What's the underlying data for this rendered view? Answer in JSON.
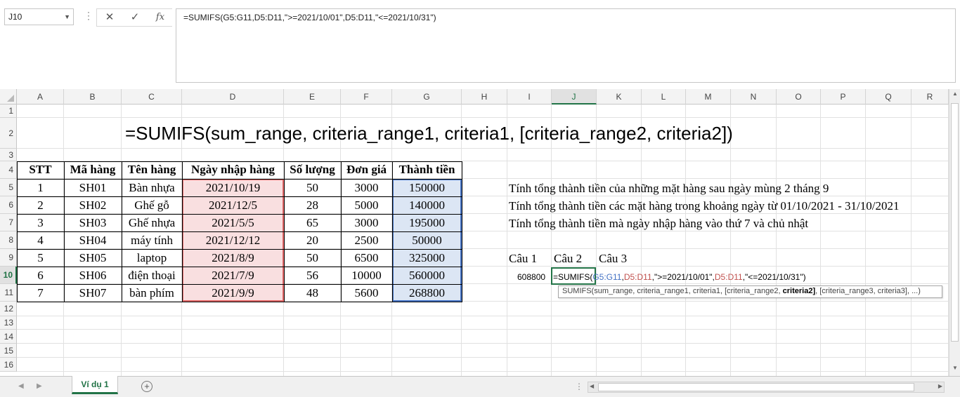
{
  "formula_bar": {
    "name_box": "J10",
    "formula": "=SUMIFS(G5:G11,D5:D11,\">=2021/10/01\",D5:D11,\"<=2021/10/31\")",
    "cancel_icon": "✕",
    "enter_icon": "✓",
    "fx_icon": "fx"
  },
  "columns": [
    "A",
    "B",
    "C",
    "D",
    "E",
    "F",
    "G",
    "H",
    "I",
    "J",
    "K",
    "L",
    "M",
    "N",
    "O",
    "P",
    "Q",
    "R"
  ],
  "rows": [
    "1",
    "2",
    "3",
    "4",
    "5",
    "6",
    "7",
    "8",
    "9",
    "10",
    "11",
    "12",
    "13",
    "14",
    "15",
    "16"
  ],
  "selected_cell": {
    "column": "J",
    "row": "10"
  },
  "title": "=SUMIFS(sum_range, criteria_range1, criteria1, [criteria_range2, criteria2])",
  "table": {
    "headers": [
      "STT",
      "Mã hàng",
      "Tên hàng",
      "Ngày nhập hàng",
      "Số lượng",
      "Đơn giá",
      "Thành tiền"
    ],
    "rows": [
      [
        "1",
        "SH01",
        "Bàn nhựa",
        "2021/10/19",
        "50",
        "3000",
        "150000"
      ],
      [
        "2",
        "SH02",
        "Ghế gỗ",
        "2021/12/5",
        "28",
        "5000",
        "140000"
      ],
      [
        "3",
        "SH03",
        "Ghế nhựa",
        "2021/5/5",
        "65",
        "3000",
        "195000"
      ],
      [
        "4",
        "SH04",
        "máy tính",
        "2021/12/12",
        "20",
        "2500",
        "50000"
      ],
      [
        "5",
        "SH05",
        "laptop",
        "2021/8/9",
        "50",
        "6500",
        "325000"
      ],
      [
        "6",
        "SH06",
        "điện thoại",
        "2021/7/9",
        "56",
        "10000",
        "560000"
      ],
      [
        "7",
        "SH07",
        "bàn phím",
        "2021/9/9",
        "48",
        "5600",
        "268800"
      ]
    ]
  },
  "notes": [
    "Tính tổng thành tiền của những mặt hàng sau ngày mùng 2 tháng 9",
    "Tính tổng thành tiền các mặt hàng trong khoảng ngày từ 01/10/2021 - 31/10/2021",
    "Tính tổng thành tiền mà ngày nhập hàng vào thứ 7 và chủ nhật"
  ],
  "questions": [
    "Câu 1",
    "Câu 2",
    "Câu 3"
  ],
  "result_value": "608800",
  "editing": {
    "prefix": "=SUMIFS(",
    "ref1": "G5:G11",
    "sep1": ",",
    "ref2": "D5:D11",
    "crit1": ",\">=2021/10/01\",",
    "ref3": "D5:D11",
    "crit2": ",\"<=2021/10/31\")"
  },
  "tooltip": {
    "part1": "SUMIFS(sum_range, criteria_range1, criteria1, [criteria_range2, ",
    "bold": "criteria2]",
    "part2": ", [criteria_range3, criteria3], ...)"
  },
  "sheet_tab": "Ví dụ 1",
  "add_sheet_icon": "+",
  "colors": {
    "accent": "#217346",
    "date_fill": "#f9dfe0",
    "date_border": "#e06666",
    "amount_fill": "#dce6f4",
    "amount_border": "#4472c4"
  }
}
